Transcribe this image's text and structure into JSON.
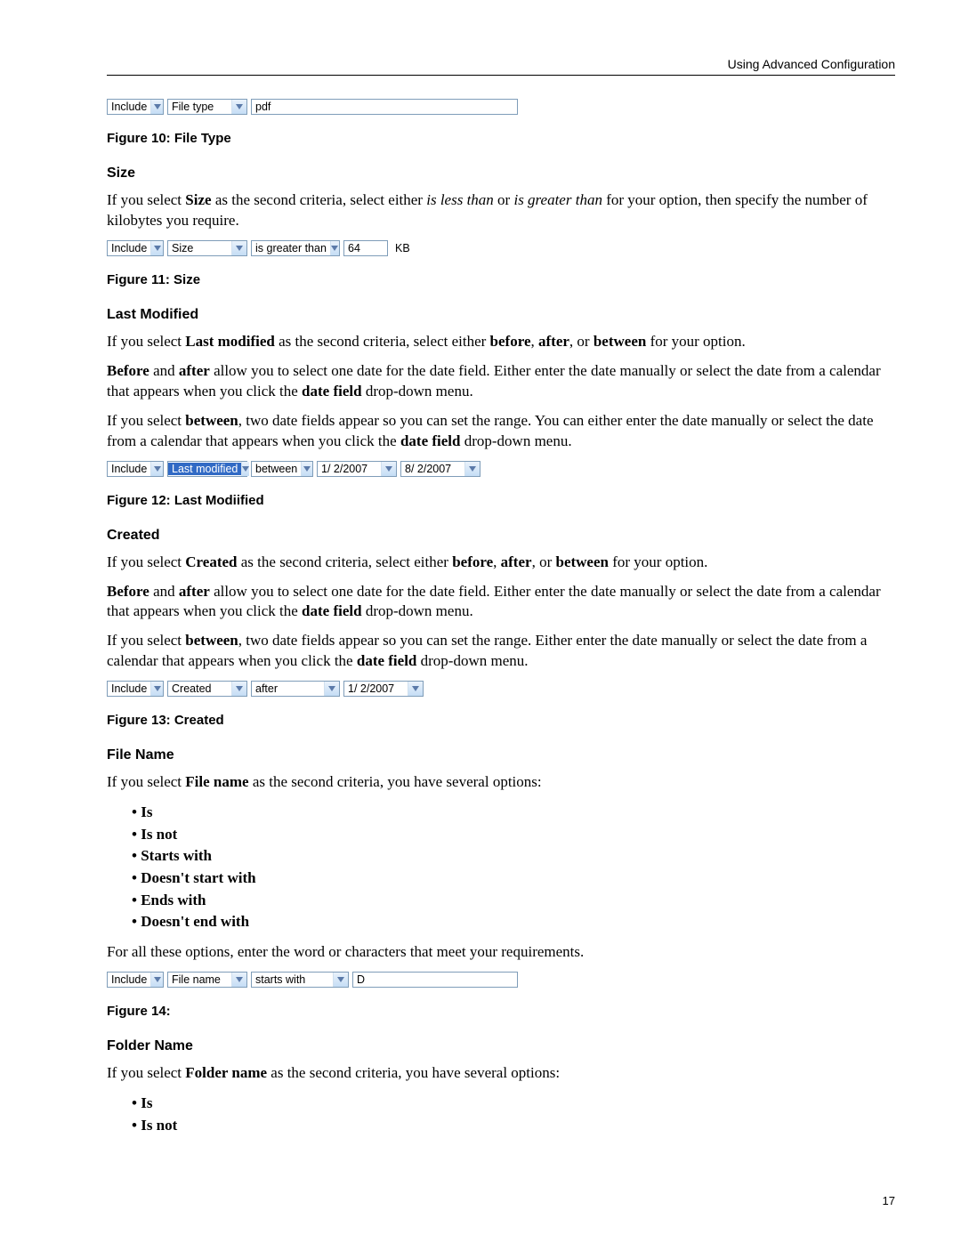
{
  "header": "Using Advanced Configuration",
  "page_number": "17",
  "fig10": {
    "caption": "Figure 10: File Type",
    "include": "Include",
    "criteria": "File type",
    "value": "pdf"
  },
  "size": {
    "heading": "Size",
    "p_1a": "If you select ",
    "p_1b": "Size",
    "p_1c": " as the second criteria, select either ",
    "p_1d": "is less than",
    "p_1e": " or ",
    "p_1f": "is greater than",
    "p_1g": " for your option, then specify the number of kilobytes you require.",
    "ui": {
      "include": "Include",
      "criteria": "Size",
      "op": "is greater than",
      "value": "64",
      "unit": "KB"
    },
    "caption": "Figure 11: Size"
  },
  "lm": {
    "heading": "Last Modified",
    "p_1a": "If you select ",
    "p_1b": "Last modified",
    "p_1c": " as the second criteria, select either ",
    "p_1d": "before",
    "comma1": ", ",
    "p_1e": "after",
    "or": ", or ",
    "p_1f": "between",
    "p_1g": " for your option.",
    "p_2a": "Before",
    "p_2b": " and ",
    "p_2c": "after",
    "p_2d": " allow you to select one date for the date field. Either enter the date manually or select the date from a calendar that appears when you click the ",
    "p_2e": "date field",
    "p_2f": " drop-down menu.",
    "p_3a": "If you select ",
    "p_3b": "between",
    "p_3c": ", two date fields appear so you can set the range. You can either enter the date manually or select the date from a calendar that appears when you click the ",
    "p_3d": "date field",
    "p_3e": " drop-down menu.",
    "ui": {
      "include": "Include",
      "criteria": "Last modified",
      "op": "between",
      "d1": " 1/ 2/2007",
      "d2": " 8/ 2/2007"
    },
    "caption": "Figure 12: Last Modiified"
  },
  "cr": {
    "heading": "Created",
    "p_1a": "If you select ",
    "p_1b": "Created",
    "p_1c": " as the second criteria, select either ",
    "p_1d": "before",
    "comma1": ", ",
    "p_1e": "after",
    "or": ", or ",
    "p_1f": "between",
    "p_1g": " for your option.",
    "p_2a": "Before",
    "p_2b": " and ",
    "p_2c": "after",
    "p_2d": " allow you to select one date for the date field. Either enter the date manually or select the date from a calendar that appears when you click the ",
    "p_2e": "date field",
    "p_2f": " drop-down menu.",
    "p_3a": "If you select ",
    "p_3b": "between",
    "p_3c": ", two date fields appear so you can set the range. Either enter the date manually or select the date from a calendar that appears when you click the ",
    "p_3d": "date field",
    "p_3e": " drop-down menu.",
    "ui": {
      "include": "Include",
      "criteria": "Created",
      "op": "after",
      "d1": " 1/ 2/2007"
    },
    "caption": "Figure 13: Created"
  },
  "fn": {
    "heading": "File Name",
    "p_1a": "If you select ",
    "p_1b": "File name",
    "p_1c": " as the second criteria, you have several options:",
    "opts": [
      "Is",
      "Is not",
      "Starts with",
      "Doesn't start with",
      "Ends with",
      "Doesn't end with"
    ],
    "p_2": "For all these options, enter the word or characters that meet your requirements.",
    "ui": {
      "include": "Include",
      "criteria": "File name",
      "op": "starts with",
      "value": "D"
    },
    "caption": "Figure 14:"
  },
  "fo": {
    "heading": "Folder Name",
    "p_1a": "If you select ",
    "p_1b": "Folder name",
    "p_1c": " as the second criteria, you have several options:",
    "opts": [
      "Is",
      "Is not"
    ]
  }
}
